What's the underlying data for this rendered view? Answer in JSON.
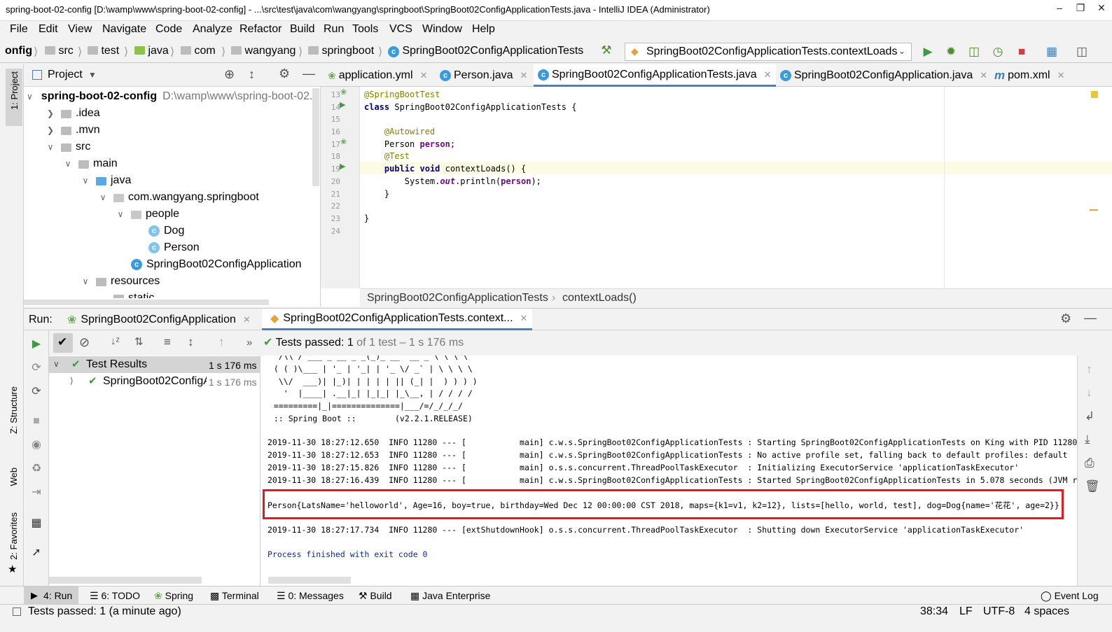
{
  "window": {
    "title": "spring-boot-02-config [D:\\wamp\\www\\spring-boot-02-config] - ...\\src\\test\\java\\com\\wangyang\\springboot\\SpringBoot02ConfigApplicationTests.java - IntelliJ IDEA (Administrator)"
  },
  "menu": [
    "File",
    "Edit",
    "View",
    "Navigate",
    "Code",
    "Analyze",
    "Refactor",
    "Build",
    "Run",
    "Tools",
    "VCS",
    "Window",
    "Help"
  ],
  "breadcrumb": [
    "onfig",
    "src",
    "test",
    "java",
    "com",
    "wangyang",
    "springboot",
    "SpringBoot02ConfigApplicationTests"
  ],
  "run_config": "SpringBoot02ConfigApplicationTests.contextLoads",
  "project": {
    "header": "Project",
    "tree": [
      {
        "label": "spring-boot-02-config",
        "hint": "D:\\wamp\\www\\spring-boot-02...",
        "indent": 0,
        "icon": "folder",
        "chev": "v"
      },
      {
        "label": ".idea",
        "indent": 1,
        "icon": "folder",
        "chev": ">"
      },
      {
        "label": ".mvn",
        "indent": 1,
        "icon": "folder",
        "chev": ">"
      },
      {
        "label": "src",
        "indent": 1,
        "icon": "folder",
        "chev": "v"
      },
      {
        "label": "main",
        "indent": 2,
        "icon": "folder",
        "chev": "v"
      },
      {
        "label": "java",
        "indent": 3,
        "icon": "folder-blue",
        "chev": "v"
      },
      {
        "label": "com.wangyang.springboot",
        "indent": 4,
        "icon": "package",
        "chev": "v"
      },
      {
        "label": "people",
        "indent": 5,
        "icon": "package",
        "chev": "v"
      },
      {
        "label": "Dog",
        "indent": 6,
        "icon": "class",
        "chev": ""
      },
      {
        "label": "Person",
        "indent": 6,
        "icon": "class",
        "chev": ""
      },
      {
        "label": "SpringBoot02ConfigApplication",
        "indent": 5,
        "icon": "springclass",
        "chev": ""
      },
      {
        "label": "resources",
        "indent": 3,
        "icon": "folder",
        "chev": "v"
      },
      {
        "label": "static",
        "indent": 4,
        "icon": "folder",
        "chev": ""
      }
    ]
  },
  "editor_tabs": [
    {
      "label": "application.yml"
    },
    {
      "label": "Person.java"
    },
    {
      "label": "SpringBoot02ConfigApplicationTests.java",
      "active": true
    },
    {
      "label": "SpringBoot02ConfigApplication.java"
    },
    {
      "label": "pom.xml"
    }
  ],
  "code": {
    "line_numbers": [
      "13",
      "14",
      "15",
      "16",
      "17",
      "18",
      "19",
      "20",
      "21",
      "22",
      "23",
      "24"
    ],
    "l13": "@SpringBootTest",
    "l14_kw": "class",
    "l14_rest": " SpringBoot02ConfigApplicationTests {",
    "l16": "@Autowired",
    "l17_type": "Person ",
    "l17_field": "person",
    "l17_end": ";",
    "l18": "@Test",
    "l19_kw1": "public",
    "l19_kw2": "void",
    "l19_rest": " contextLoads() {",
    "l20_a": "System.",
    "l20_out": "out",
    "l20_b": ".println(",
    "l20_field": "person",
    "l20_c": ");",
    "l21": "}",
    "l23": "}"
  },
  "editor_breadcrumb": {
    "class": "SpringBoot02ConfigApplicationTests",
    "method": "contextLoads()"
  },
  "run": {
    "label": "Run:",
    "tabs": [
      {
        "label": "SpringBoot02ConfigApplication"
      },
      {
        "label": "SpringBoot02ConfigApplicationTests.context...",
        "active": true
      }
    ],
    "status_bold": "Tests passed: 1",
    "status_rest": " of 1 test – 1 s 176 ms",
    "tree": [
      {
        "label": "Test Results",
        "time": "1 s 176 ms"
      },
      {
        "label": "SpringBoot02ConfigA",
        "time": "1 s 176 ms"
      }
    ]
  },
  "console": {
    "banner": [
      "  /\\\\ / ___'_ __ _ _(_)_ __  __ _ \\ \\ \\ \\",
      " ( ( )\\___ | '_ | '_| | '_ \\/ _` | \\ \\ \\ \\",
      "  \\\\/  ___)| |_)| | | | | || (_| |  ) ) ) )",
      "   '  |____| .__|_| |_|_| |_\\__, | / / / /",
      " =========|_|==============|___/=/_/_/_/",
      " :: Spring Boot ::        (v2.2.1.RELEASE)"
    ],
    "logs": [
      "2019-11-30 18:27:12.650  INFO 11280 --- [           main] c.w.s.SpringBoot02ConfigApplicationTests : Starting SpringBoot02ConfigApplicationTests on King with PID 11280",
      "2019-11-30 18:27:12.653  INFO 11280 --- [           main] c.w.s.SpringBoot02ConfigApplicationTests : No active profile set, falling back to default profiles: default",
      "2019-11-30 18:27:15.826  INFO 11280 --- [           main] o.s.s.concurrent.ThreadPoolTaskExecutor  : Initializing ExecutorService 'applicationTaskExecutor'",
      "2019-11-30 18:27:16.439  INFO 11280 --- [           main] c.w.s.SpringBoot02ConfigApplicationTests : Started SpringBoot02ConfigApplicationTests in 5.078 seconds (JVM r"
    ],
    "person_output": "Person{LatsName='helloworld', Age=16, boy=true, birthday=Wed Dec 12 00:00:00 CST 2018, maps={k1=v1, k2=12}, lists=[hello, world, test], dog=Dog{name='花花', age=2}}",
    "shutdown": "2019-11-30 18:27:17.734  INFO 11280 --- [extShutdownHook] o.s.s.concurrent.ThreadPoolTaskExecutor  : Shutting down ExecutorService 'applicationTaskExecutor'",
    "exit": "Process finished with exit code 0"
  },
  "left_strip": {
    "project": "1: Project",
    "structure": "Z: Structure",
    "web": "Web",
    "favorites": "2: Favorites"
  },
  "bottom_tabs": [
    "4: Run",
    "6: TODO",
    "Spring",
    "Terminal",
    "0: Messages",
    "Build",
    "Java Enterprise"
  ],
  "event_log": "Event Log",
  "status": {
    "message": "Tests passed: 1 (a minute ago)",
    "position": "38:34",
    "line_sep": "LF",
    "encoding": "UTF-8",
    "indent": "4 spaces"
  },
  "colors": {
    "highlight_box": "#e8191b",
    "accent_tab": "#4083c9",
    "pass_green": "#3f9b3f"
  }
}
